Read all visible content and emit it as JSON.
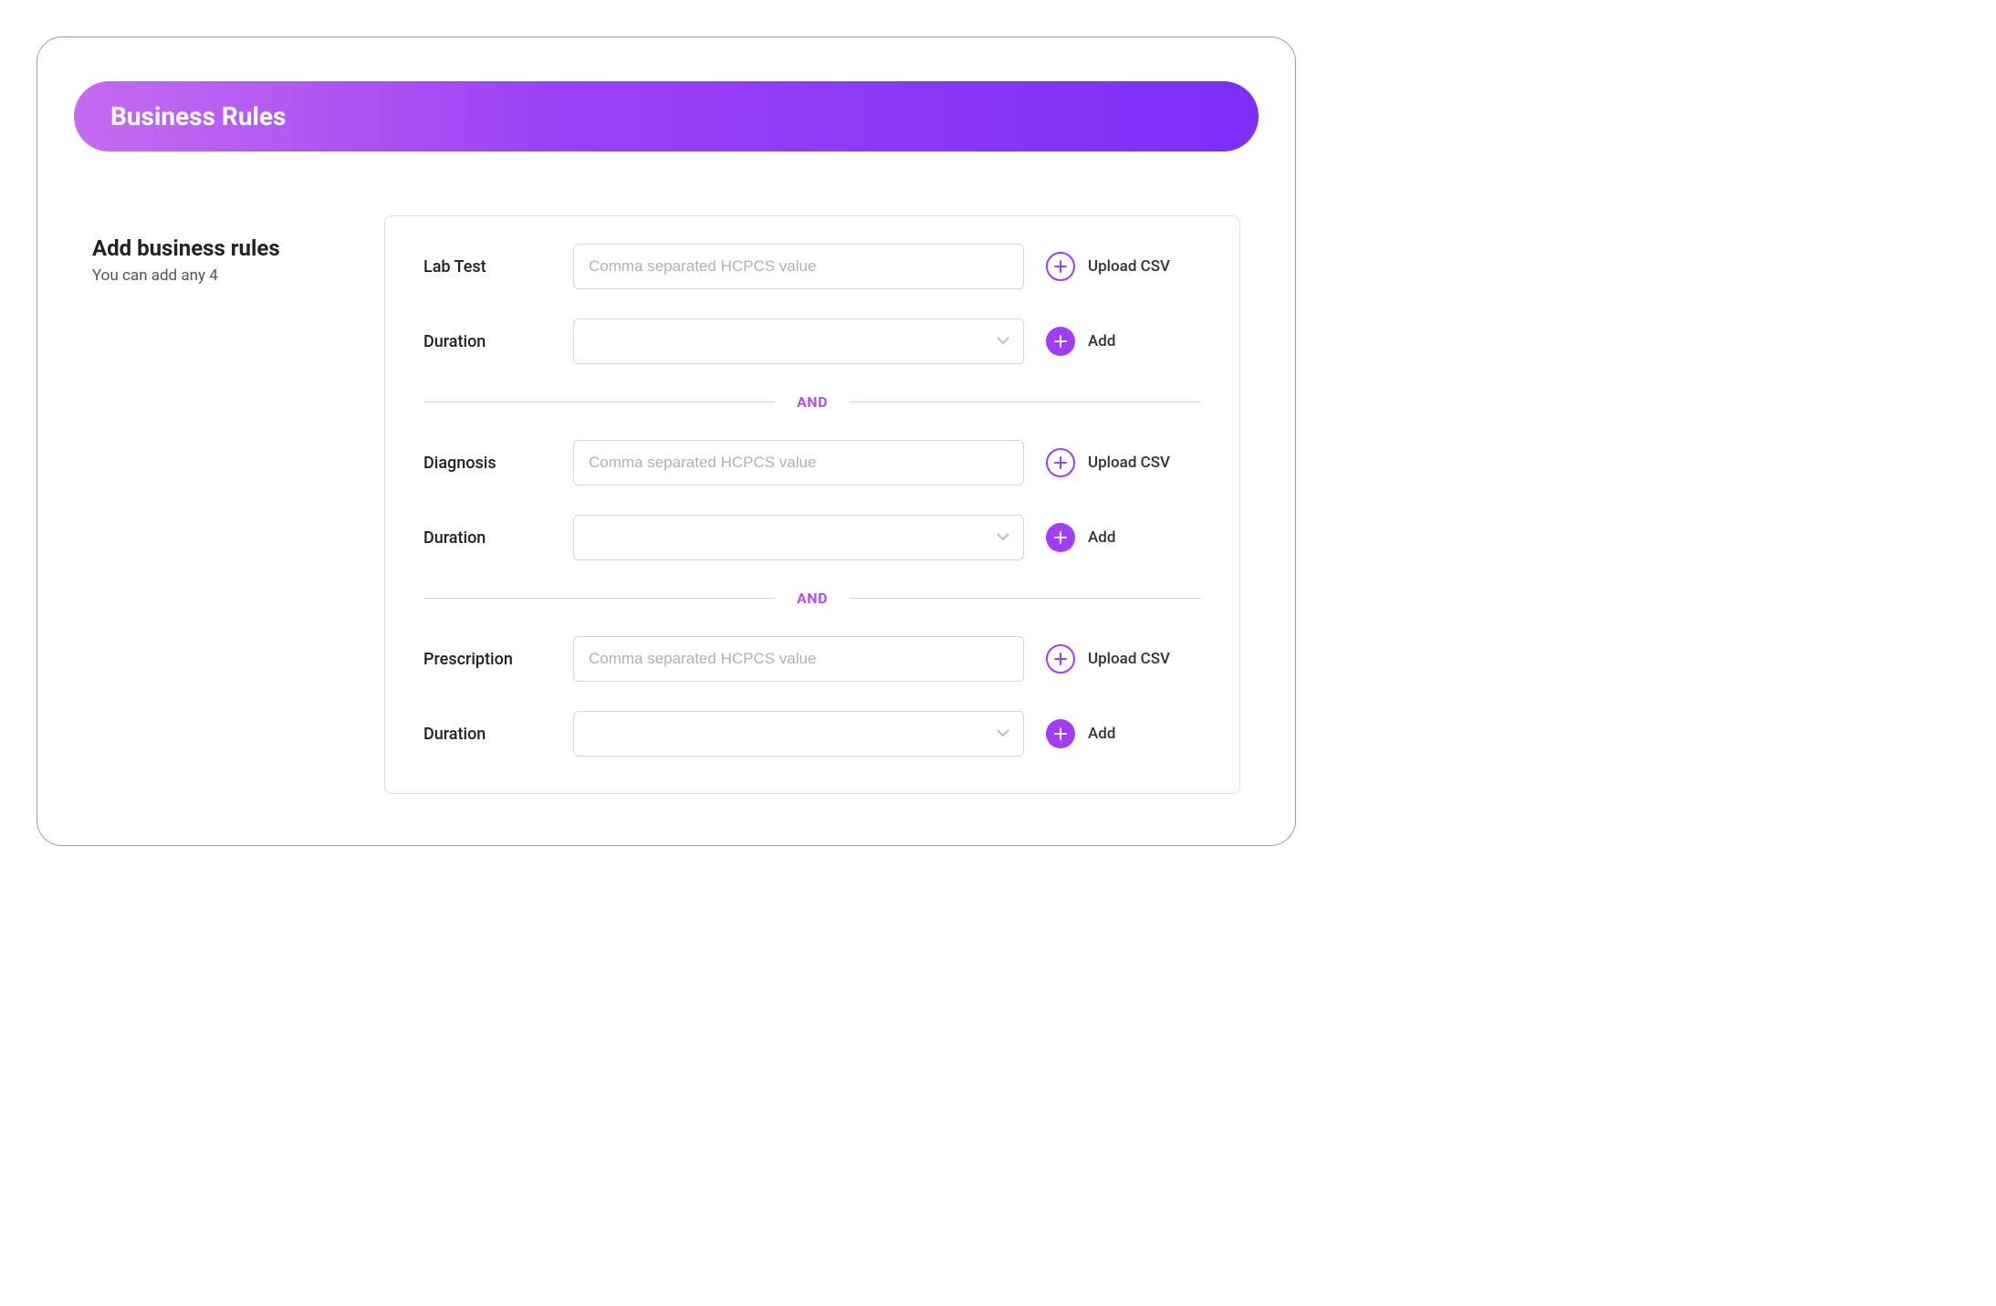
{
  "header": {
    "title": "Business Rules"
  },
  "sidebar": {
    "title": "Add business rules",
    "subtitle": "You can add any 4"
  },
  "labels": {
    "upload_csv": "Upload CSV",
    "add": "Add",
    "and": "AND"
  },
  "rules": [
    {
      "value_label": "Lab Test",
      "value_placeholder": "Comma separated HCPCS value",
      "duration_label": "Duration"
    },
    {
      "value_label": "Diagnosis",
      "value_placeholder": "Comma separated HCPCS value",
      "duration_label": "Duration"
    },
    {
      "value_label": "Prescription",
      "value_placeholder": "Comma separated HCPCS value",
      "duration_label": "Duration"
    }
  ]
}
